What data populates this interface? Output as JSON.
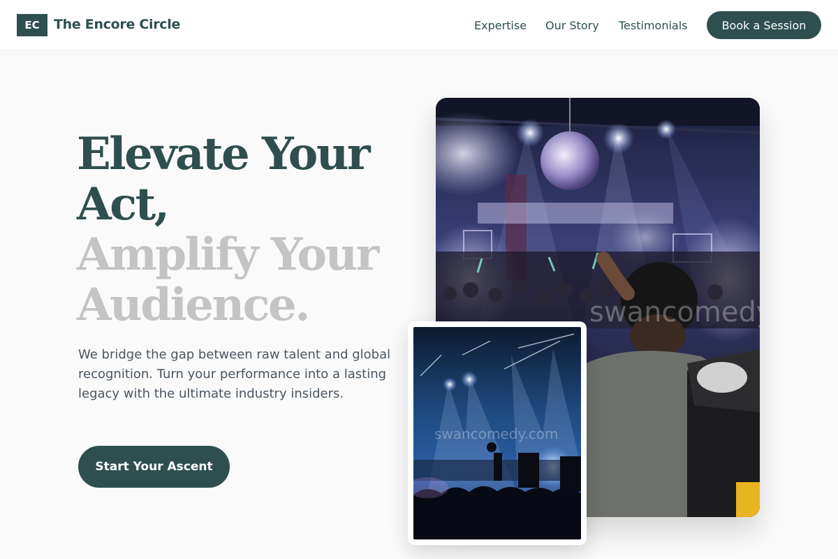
{
  "header": {
    "logo_initials": "EC",
    "brand_name": "The Encore Circle",
    "nav": {
      "expertise": "Expertise",
      "our_story": "Our Story",
      "testimonials": "Testimonials"
    },
    "book_label": "Book a Session"
  },
  "hero": {
    "headline_line1": "Elevate Your Act,",
    "headline_line2": "Amplify Your Audience.",
    "subtitle": "We bridge the gap between raw talent and global recognition. Turn your performance into a lasting legacy with the ultimate industry insiders.",
    "cta_label": "Start Your Ascent"
  },
  "images": {
    "main_watermark": "swancomedy.com",
    "small_watermark": "swancomedy.com"
  },
  "colors": {
    "primary": "#2f4f4f",
    "muted_headline": "#c4c4c4",
    "background": "#fafafa"
  }
}
